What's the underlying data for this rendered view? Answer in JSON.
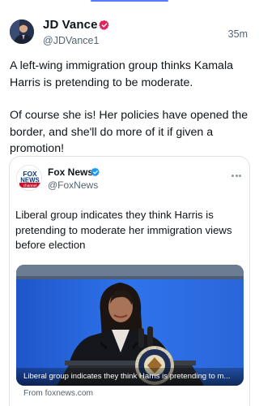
{
  "colors": {
    "accent": "#5b7cfa",
    "verified": "#e0245e",
    "verified_blue": "#1d9bf0",
    "text_primary": "#0f1419",
    "text_secondary": "#536471",
    "border": "#dfe3e8"
  },
  "tweet": {
    "author": {
      "name": "JD Vance",
      "handle": "@JDVance1",
      "verified_icon": "verified-badge-icon",
      "avatar_icon": "profile-photo"
    },
    "timestamp": "35m",
    "text": {
      "paragraph_1": "A left-wing immigration group thinks Kamala Harris is pretending to be moderate.",
      "paragraph_2": "Of course she is! Her policies have opened the border, and she'll do more of it if given a promotion!"
    },
    "quote": {
      "author": {
        "name": "Fox News",
        "handle": "@FoxNews",
        "logo_lines": [
          "FOX",
          "NEWS",
          "channel"
        ],
        "verified_icon": "verified-badge-icon"
      },
      "more_icon": "more-dots-icon",
      "text": "Liberal group indicates they think Harris is pretending to moderate her immigration views before election",
      "media": {
        "caption": "Liberal group indicates they think Harris is pretending to m...",
        "seal_text": "SEAL OF THE UNITED"
      },
      "source": "From foxnews.com"
    }
  }
}
